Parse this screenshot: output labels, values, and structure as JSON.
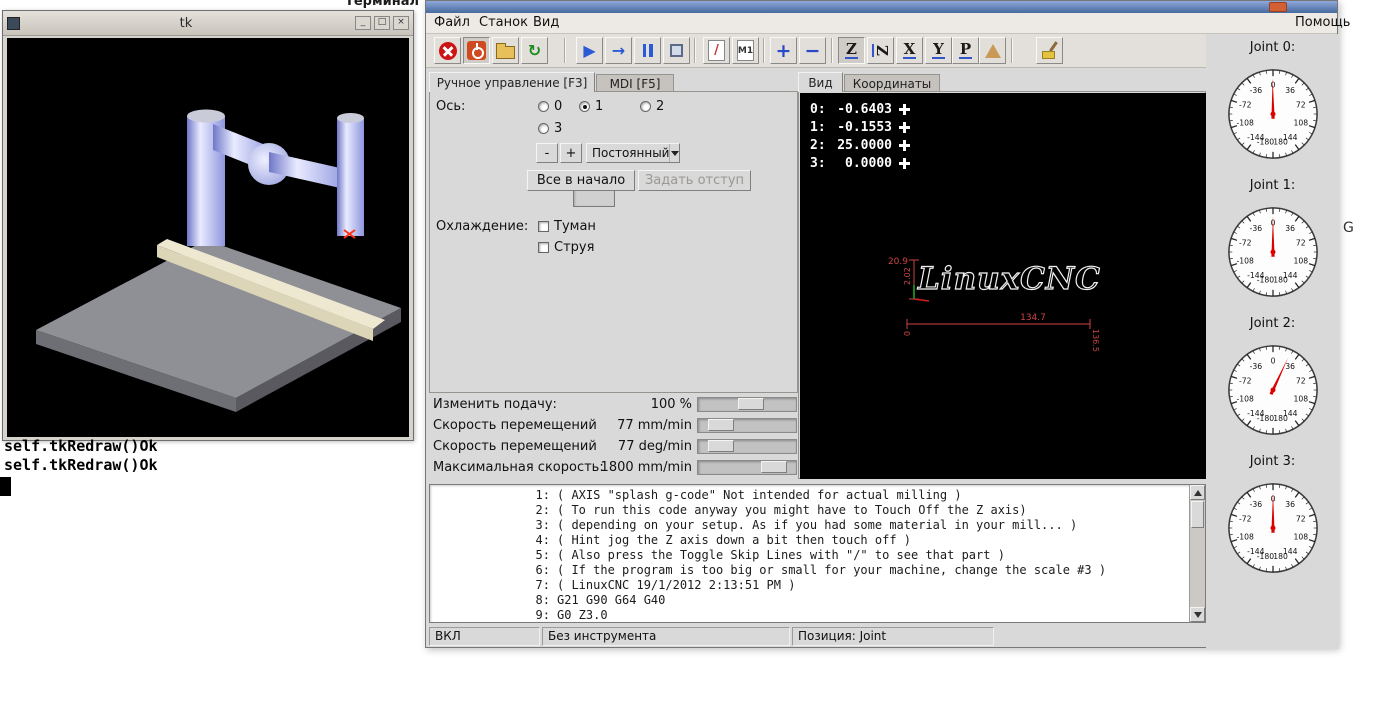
{
  "desktop": {
    "terminal_window_title": "Терминал",
    "terminal_lines": [
      "self.tkRedraw()Ok",
      "self.tkRedraw()Ok"
    ],
    "stray_text": "G"
  },
  "tk_window": {
    "title": "tk",
    "controls": {
      "minimize": "_",
      "maximize": "□",
      "close": "×"
    }
  },
  "axis_window": {
    "menubar": {
      "items": [
        "Файл",
        "Станок",
        "Вид"
      ],
      "help": "Помощь"
    },
    "toolbar": {
      "icons": {
        "reload": "↻",
        "run": "▶",
        "step": "→",
        "skip": "/",
        "m1": "M1",
        "zoom_in": "+",
        "zoom_out": "−",
        "view_z": "Z",
        "view_z_rot": "Z",
        "view_x": "X",
        "view_y": "Y",
        "view_p": "P"
      }
    },
    "left_tabs": {
      "manual": "Ручное управление [F3]",
      "mdi": "MDI [F5]"
    },
    "manual": {
      "axis_label": "Ось:",
      "axis_options": [
        "0",
        "1",
        "2",
        "3"
      ],
      "selected_axis": "1",
      "jog_minus": "-",
      "jog_plus": "+",
      "jog_mode": "Постоянный",
      "home_all_button": "Все в начало",
      "touch_off_button": "Задать отступ",
      "coolant_label": "Охлаждение:",
      "mist_checkbox": "Туман",
      "flood_checkbox": "Струя"
    },
    "sliders": [
      {
        "label": "Изменить подачу:",
        "value": "100 %",
        "percent": 55
      },
      {
        "label": "Скорость перемещений",
        "value": "77 mm/min",
        "percent": 14
      },
      {
        "label": "Скорость перемещений",
        "value": "77 deg/min",
        "percent": 14
      },
      {
        "label": "Максимальная скорость:",
        "value": "1800 mm/min",
        "percent": 88
      }
    ],
    "preview_tabs": {
      "view": "Вид",
      "coords": "Координаты"
    },
    "coordinates": [
      {
        "axis": "0:",
        "value": "-0.6403"
      },
      {
        "axis": "1:",
        "value": "-0.1553"
      },
      {
        "axis": "2:",
        "value": "25.0000"
      },
      {
        "axis": "3:",
        "value": "0.0000"
      }
    ],
    "preview": {
      "logo": "LinuxCNC",
      "dim_color": "#cc4444",
      "dims": {
        "y_extent": "20.9",
        "y_offset": "2.02",
        "x_extent": "134.7",
        "x_min": "0",
        "x_max": "136.5"
      }
    },
    "gcode_lines": [
      {
        "n": "1:",
        "text": "( AXIS \"splash g-code\" Not intended for actual milling )"
      },
      {
        "n": "2:",
        "text": "( To run this code anyway you might have to Touch Off the Z axis)"
      },
      {
        "n": "3:",
        "text": "( depending on your setup. As if you had some material in your mill... )"
      },
      {
        "n": "4:",
        "text": "( Hint jog the Z axis down a bit then touch off )"
      },
      {
        "n": "5:",
        "text": "( Also press the Toggle Skip Lines with \"/\" to see that part )"
      },
      {
        "n": "6:",
        "text": "( If the program is too big or small for your machine, change the scale #3 )"
      },
      {
        "n": "7:",
        "text": "( LinuxCNC 19/1/2012 2:13:51 PM )"
      },
      {
        "n": "8:",
        "text": "G21 G90 G64 G40"
      },
      {
        "n": "9:",
        "text": "G0 Z3.0"
      }
    ],
    "status_bar": [
      "ВКЛ",
      "Без инструмента",
      "Позиция: Joint"
    ]
  },
  "pyvcp": {
    "needle_color": "#dd0000",
    "scale": {
      "min": -180,
      "max": 180,
      "major_step": 36,
      "tick_labels": [
        "0",
        "36",
        "72",
        "108",
        "144",
        "180",
        "-180",
        "-144",
        "-108",
        "-72",
        "-36"
      ]
    },
    "gauges": [
      {
        "label": "Joint 0:",
        "value": -0.6403
      },
      {
        "label": "Joint 1:",
        "value": -0.1553
      },
      {
        "label": "Joint 2:",
        "value": 25.0
      },
      {
        "label": "Joint 3:",
        "value": 0.0
      }
    ]
  }
}
